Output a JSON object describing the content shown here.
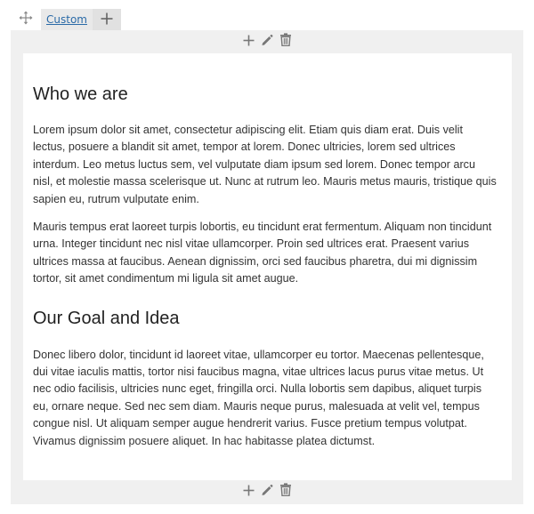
{
  "tabs": {
    "move_icon": "move-icon",
    "custom_label": "Custom",
    "add_icon": "plus-icon"
  },
  "actions": {
    "add_icon": "plus-icon",
    "edit_icon": "pencil-icon",
    "delete_icon": "trash-icon"
  },
  "content": {
    "heading1": "Who we are",
    "para1": "Lorem ipsum dolor sit amet, consectetur adipiscing elit. Etiam quis diam erat. Duis velit lectus, posuere a blandit sit amet, tempor at lorem. Donec ultricies, lorem sed ultrices interdum. Leo metus luctus sem, vel vulputate diam ipsum sed lorem. Donec tempor arcu nisl, et molestie massa scelerisque ut. Nunc at rutrum leo. Mauris metus mauris, tristique quis sapien eu, rutrum vulputate enim.",
    "para2": "Mauris tempus erat laoreet turpis lobortis, eu tincidunt erat fermentum. Aliquam non tincidunt urna. Integer tincidunt nec nisl vitae ullamcorper. Proin sed ultrices erat. Praesent varius ultrices massa at faucibus. Aenean dignissim, orci sed faucibus pharetra, dui mi dignissim tortor, sit amet condimentum mi ligula sit amet augue.",
    "heading2": "Our Goal and Idea",
    "para3": "Donec libero dolor, tincidunt id laoreet vitae, ullamcorper eu tortor. Maecenas pellentesque, dui vitae iaculis mattis, tortor nisi faucibus magna, vitae ultrices lacus purus vitae metus. Ut nec odio facilisis, ultricies nunc eget, fringilla orci. Nulla lobortis sem dapibus, aliquet turpis eu, ornare neque. Sed nec sem diam. Mauris neque purus, malesuada at velit vel, tempus congue nisl. Ut aliquam semper augue hendrerit varius. Fusce pretium tempus volutpat. Vivamus dignissim posuere aliquet. In hac habitasse platea dictumst."
  },
  "colors": {
    "link": "#2a6aa7",
    "icon": "#777777",
    "frame": "#f0f0f0"
  }
}
